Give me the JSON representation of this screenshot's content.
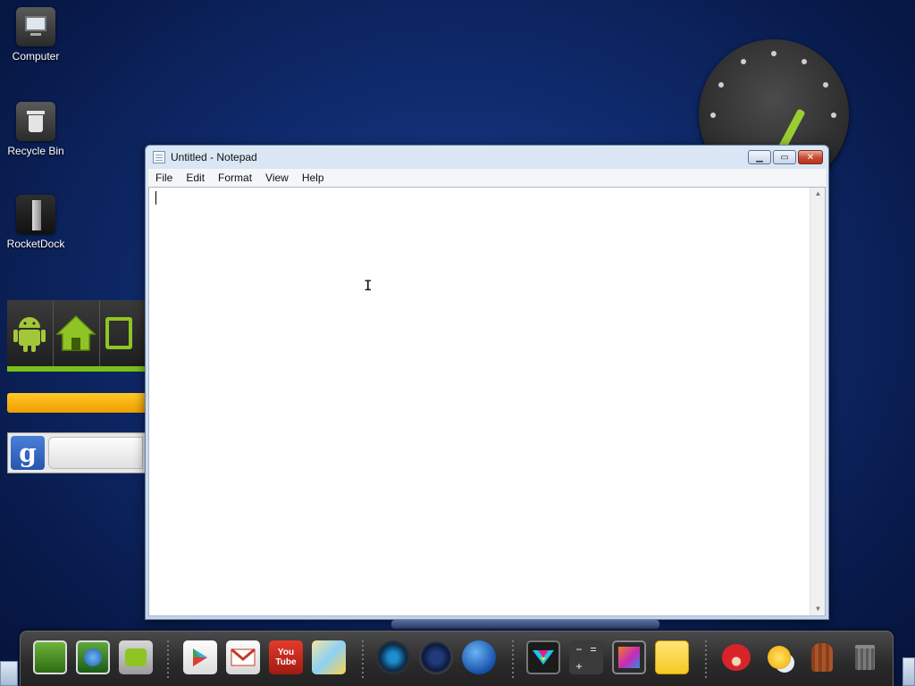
{
  "desktop": {
    "icons": [
      {
        "label": "Computer",
        "icon": "computer-icon"
      },
      {
        "label": "Recycle Bin",
        "icon": "recycle-bin-icon"
      },
      {
        "label": "RocketDock",
        "icon": "rocketdock-icon"
      }
    ]
  },
  "google_widget": {
    "logo_text": "g"
  },
  "notepad": {
    "title": "Untitled - Notepad",
    "menus": [
      "File",
      "Edit",
      "Format",
      "View",
      "Help"
    ],
    "content": "",
    "controls": {
      "minimize": "▁",
      "maximize": "▭",
      "close": "✕"
    }
  },
  "dock": {
    "items": [
      "photo-gallery-icon",
      "browser-globe-icon",
      "folder-icon",
      "play-store-icon",
      "gmail-icon",
      "youtube-icon",
      "maps-icon",
      "camera-icon",
      "speaker-icon",
      "earth-icon",
      "color-triangle-icon",
      "calculator-icon",
      "picture-frame-icon",
      "sticky-note-icon",
      "angry-birds-icon",
      "weather-icon",
      "gingerbread-icon",
      "trash-can-icon"
    ],
    "youtube_label": "You Tube"
  },
  "colors": {
    "desktop_bg": "#0f2a6b",
    "android_green": "#7bbf1a",
    "window_frame": "#c3d5ec"
  }
}
